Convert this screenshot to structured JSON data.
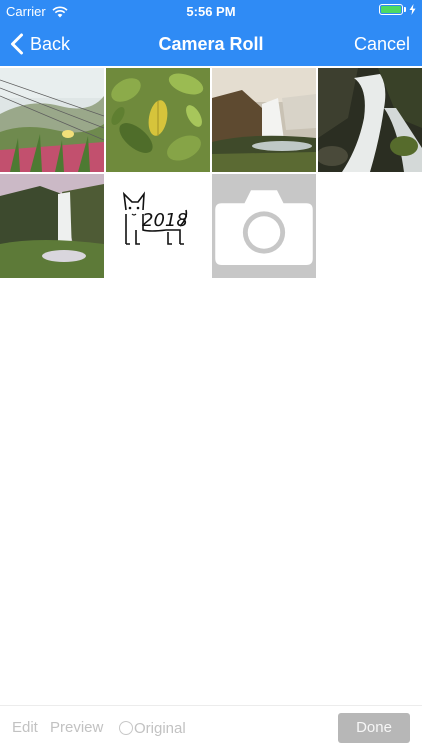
{
  "status_bar": {
    "carrier": "Carrier",
    "time": "5:56 PM",
    "wifi_icon": "wifi-icon",
    "battery_icon": "battery-icon",
    "charging_icon": "bolt-icon"
  },
  "nav": {
    "back_label": "Back",
    "back_icon": "chevron-left-icon",
    "title": "Camera Roll",
    "cancel_label": "Cancel"
  },
  "photos": [
    {
      "name": "coastal-meadow-photo",
      "description_visible": false
    },
    {
      "name": "green-leaves-photo",
      "description_visible": false
    },
    {
      "name": "waterfall-cliff-photo",
      "description_visible": false
    },
    {
      "name": "rocky-waterfall-photo",
      "description_visible": false
    },
    {
      "name": "tall-waterfall-photo",
      "description_visible": false
    },
    {
      "name": "dog-sketch-2018-photo",
      "sketch_text": "2018"
    },
    {
      "name": "camera-placeholder",
      "icon": "camera-icon"
    }
  ],
  "toolbar": {
    "edit_label": "Edit",
    "preview_label": "Preview",
    "original_label": "Original",
    "done_label": "Done"
  },
  "colors": {
    "nav_background": "#2f8bf5",
    "nav_text": "#ffffff",
    "battery_fill": "#4cd964",
    "toolbar_text_disabled": "#c2c2c2",
    "done_background": "#b7b7b7",
    "camera_cell_background": "#c7c7c7"
  }
}
